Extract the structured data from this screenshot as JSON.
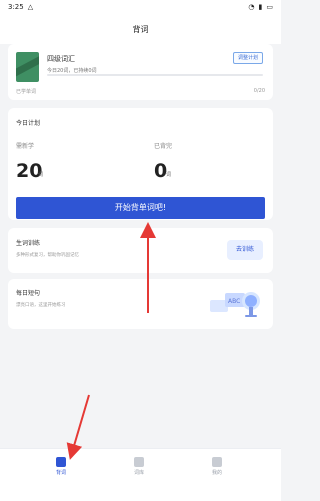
{
  "status": {
    "time": "3:25",
    "carrier_icon": "signal-icon"
  },
  "header": {
    "title": "背词"
  },
  "book": {
    "title": "四级词汇",
    "subtitle": "今日20词，已持续0词",
    "change_plan": "调整计划",
    "learned_label": "已学单词",
    "learned_count": "0/20",
    "progress_percent": 0
  },
  "plan": {
    "title": "今日计划",
    "left_label": "需新学",
    "left_value": "20",
    "left_unit": "词",
    "right_label": "已背完",
    "right_value": "0",
    "right_unit": "词",
    "start_button": "开始背单词吧!"
  },
  "training": {
    "title": "生词训练",
    "desc": "多种形式复习，帮助你巩固记忆",
    "button": "去训练"
  },
  "daily": {
    "title": "每日短句",
    "desc": "漂亮口语，这里开始练习"
  },
  "tabs": [
    {
      "label": "背词",
      "icon": "book-icon"
    },
    {
      "label": "词库",
      "icon": "library-icon"
    },
    {
      "label": "我的",
      "icon": "profile-icon"
    }
  ]
}
